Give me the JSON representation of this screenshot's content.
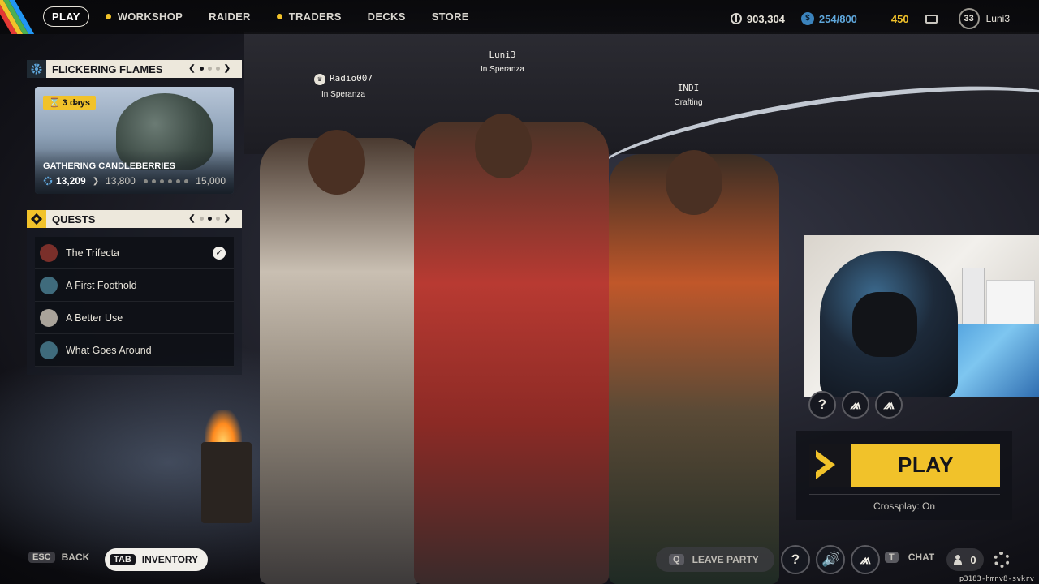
{
  "nav": {
    "play": "PLAY",
    "workshop": "WORKSHOP",
    "raider": "RAIDER",
    "traders": "TRADERS",
    "decks": "DECKS",
    "store": "STORE"
  },
  "stats": {
    "currency": "903,304",
    "tokens": "254/800",
    "bars": "450",
    "level": "33",
    "username": "Luni3"
  },
  "event": {
    "title": "FLICKERING FLAMES",
    "time_left": "3 days",
    "name": "GATHERING CANDLEBERRIES",
    "current": "13,209",
    "next": "13,800",
    "max": "15,000",
    "pager_icon_prev": "chevron-left-icon",
    "pager_icon_next": "chevron-right-icon"
  },
  "quests": {
    "title": "QUESTS",
    "items": [
      {
        "name": "The Trifecta",
        "completed": true,
        "icon_color": "#7a2f2a"
      },
      {
        "name": "A First Foothold",
        "completed": false,
        "icon_color": "#3f6b7c"
      },
      {
        "name": "A Better Use",
        "completed": false,
        "icon_color": "#a9a39a"
      },
      {
        "name": "What Goes Around",
        "completed": false,
        "icon_color": "#3f6b7c"
      }
    ]
  },
  "party": [
    {
      "name": "Radio007",
      "status": "In Speranza",
      "leader": true
    },
    {
      "name": "Luni3",
      "status": "In Speranza",
      "leader": false
    },
    {
      "name": "INDI",
      "status": "Crafting",
      "leader": false
    }
  ],
  "play_area": {
    "slot_help": "?",
    "play_label": "PLAY",
    "crossplay": "Crossplay: On"
  },
  "bottom": {
    "esc_key": "ESC",
    "back": "BACK",
    "tab_key": "TAB",
    "inventory": "INVENTORY",
    "leave_key": "Q",
    "leave_party": "LEAVE PARTY",
    "help": "?",
    "chat_key": "T",
    "chat": "CHAT",
    "friends_count": "0",
    "session_id": "p3183-hmnv8-svkrv"
  },
  "colors": {
    "accent_yellow": "#f1c22a",
    "panel_cream": "#ede8dc",
    "token_blue": "#3b83bd"
  }
}
